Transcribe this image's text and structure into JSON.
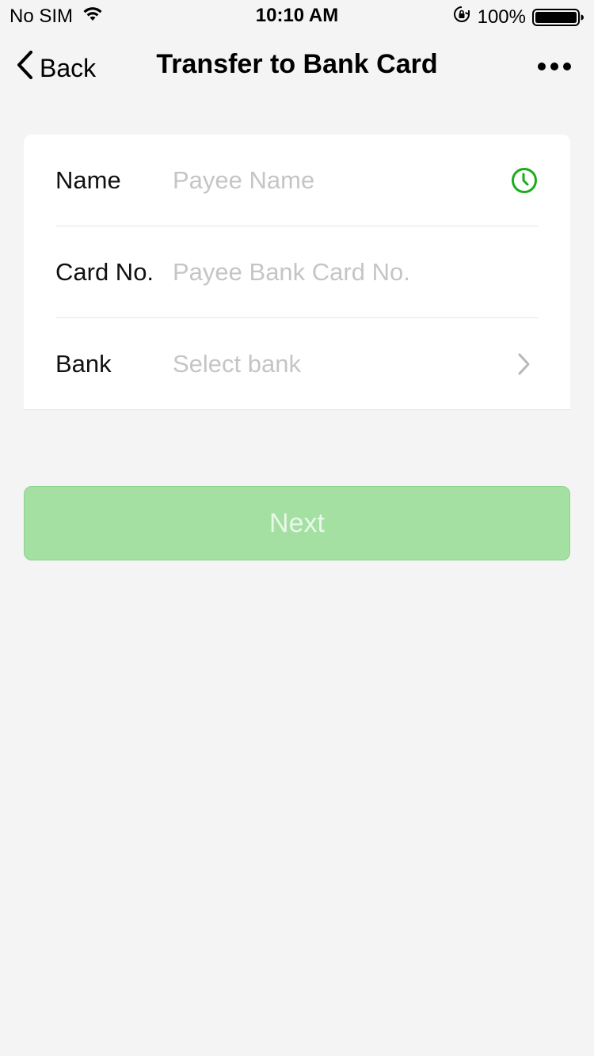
{
  "status_bar": {
    "carrier": "No SIM",
    "time": "10:10 AM",
    "battery": "100%"
  },
  "nav": {
    "back_label": "Back",
    "title": "Transfer to Bank Card"
  },
  "form": {
    "name": {
      "label": "Name",
      "placeholder": "Payee Name",
      "value": ""
    },
    "card_no": {
      "label": "Card No.",
      "placeholder": "Payee Bank Card No.",
      "value": ""
    },
    "bank": {
      "label": "Bank",
      "placeholder": "Select bank"
    }
  },
  "next_button": {
    "label": "Next"
  },
  "colors": {
    "accent": "#1aad19",
    "button_disabled": "#a3e0a2",
    "background": "#f4f4f5",
    "placeholder": "#c5c5c7"
  }
}
